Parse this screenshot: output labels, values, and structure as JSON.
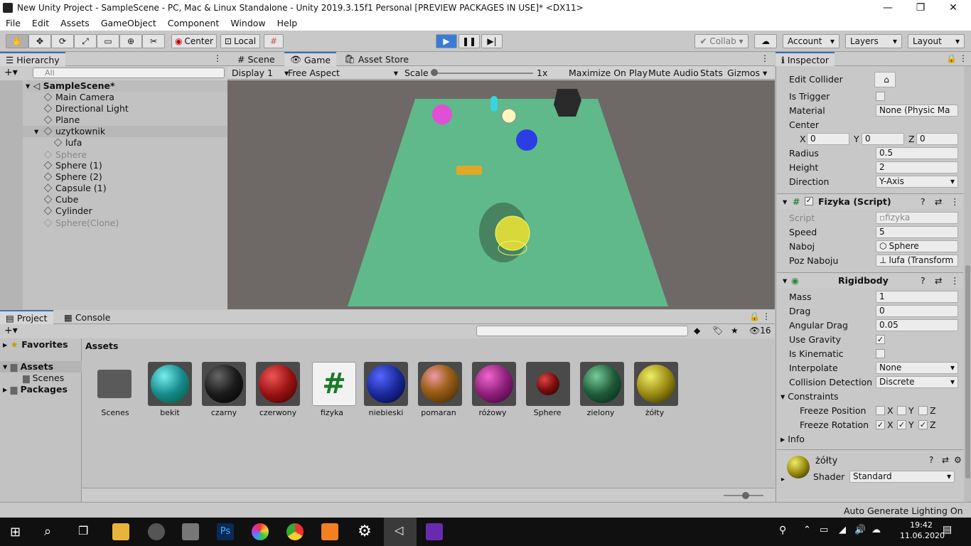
{
  "title": "New Unity Project - SampleScene - PC, Mac & Linux Standalone - Unity 2019.3.15f1 Personal [PREVIEW PACKAGES IN USE]* <DX11>",
  "menu": [
    "File",
    "Edit",
    "Assets",
    "GameObject",
    "Component",
    "Window",
    "Help"
  ],
  "toolbar": {
    "center": "Center",
    "local": "Local",
    "collab": "Collab",
    "account": "Account",
    "layers": "Layers",
    "layout": "Layout"
  },
  "hierarchy": {
    "tab": "Hierarchy",
    "search_placeholder": "All",
    "scene": "SampleScene*",
    "items": [
      {
        "name": "Main Camera",
        "indent": 1,
        "dim": false
      },
      {
        "name": "Directional Light",
        "indent": 1,
        "dim": false
      },
      {
        "name": "Plane",
        "indent": 1,
        "dim": false
      },
      {
        "name": "uzytkownik",
        "indent": 1,
        "dim": false
      },
      {
        "name": "lufa",
        "indent": 2,
        "dim": false
      },
      {
        "name": "Sphere",
        "indent": 1,
        "dim": true
      },
      {
        "name": "Sphere (1)",
        "indent": 1,
        "dim": false
      },
      {
        "name": "Sphere (2)",
        "indent": 1,
        "dim": false
      },
      {
        "name": "Capsule (1)",
        "indent": 1,
        "dim": false
      },
      {
        "name": "Cube",
        "indent": 1,
        "dim": false
      },
      {
        "name": "Cylinder",
        "indent": 1,
        "dim": false
      },
      {
        "name": "Sphere(Clone)",
        "indent": 1,
        "dim": true
      }
    ]
  },
  "viewtabs": {
    "scene": "Scene",
    "game": "Game",
    "store": "Asset Store"
  },
  "gamebar": {
    "display": "Display 1",
    "aspect": "Free Aspect",
    "scale_label": "Scale",
    "scale_value": "1x",
    "maximize": "Maximize On Play",
    "mute": "Mute Audio",
    "stats": "Stats",
    "gizmos": "Gizmos"
  },
  "project": {
    "tab": "Project",
    "console": "Console",
    "count": "16",
    "favorites": "Favorites",
    "assets": "Assets",
    "scenes": "Scenes",
    "packages": "Packages",
    "breadcrumb": "Assets",
    "items": [
      {
        "name": "Scenes",
        "color": "folder"
      },
      {
        "name": "bekit",
        "color": "#178a8c"
      },
      {
        "name": "czarny",
        "color": "#1a1a1a"
      },
      {
        "name": "czerwony",
        "color": "#9a1212"
      },
      {
        "name": "fizyka",
        "color": "script"
      },
      {
        "name": "niebieski",
        "color": "#1a2a9a"
      },
      {
        "name": "pomaran",
        "color": "#a0621a"
      },
      {
        "name": "różowy",
        "color": "#8e1f7a"
      },
      {
        "name": "Sphere",
        "color": "#7a0e0e"
      },
      {
        "name": "zielony",
        "color": "#1f5a38"
      },
      {
        "name": "żółty",
        "color": "#9a8a12"
      }
    ]
  },
  "inspector": {
    "tab": "Inspector",
    "collider": {
      "edit": "Edit Collider",
      "trigger": "Is Trigger",
      "material": "Material",
      "material_val": "None (Physic Ma",
      "center": "Center",
      "x": "0",
      "y": "0",
      "z": "0",
      "radius": "Radius",
      "radius_val": "0.5",
      "height": "Height",
      "height_val": "2",
      "direction": "Direction",
      "direction_val": "Y-Axis"
    },
    "script": {
      "header": "Fizyka (Script)",
      "script": "Script",
      "script_val": "fizyka",
      "speed": "Speed",
      "speed_val": "5",
      "naboj": "Naboj",
      "naboj_val": "Sphere",
      "poz": "Poz Naboju",
      "poz_val": "lufa (Transform"
    },
    "rigidbody": {
      "header": "Rigidbody",
      "mass": "Mass",
      "mass_val": "1",
      "drag": "Drag",
      "drag_val": "0",
      "angular": "Angular Drag",
      "angular_val": "0.05",
      "gravity": "Use Gravity",
      "kinematic": "Is Kinematic",
      "interpolate": "Interpolate",
      "interpolate_val": "None",
      "collision": "Collision Detection",
      "collision_val": "Discrete",
      "constraints": "Constraints",
      "freeze_pos": "Freeze Position",
      "freeze_rot": "Freeze Rotation",
      "info": "Info"
    },
    "material": {
      "name": "żółty",
      "shader": "Shader",
      "shader_val": "Standard"
    }
  },
  "status": "Auto Generate Lighting On",
  "tray": {
    "time": "19:42",
    "date": "11.06.2020"
  }
}
